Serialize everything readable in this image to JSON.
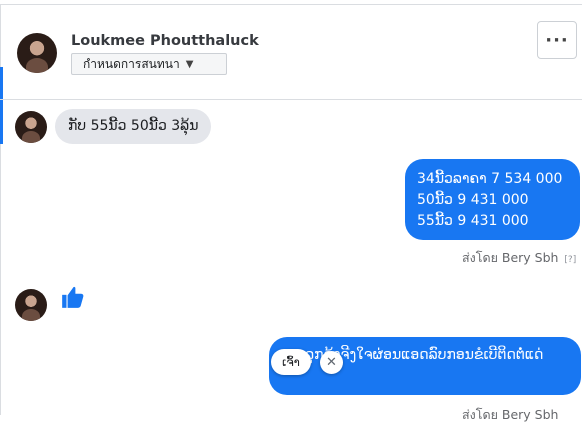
{
  "header": {
    "contact_name": "Loukmee Phoutthaluck",
    "dropdown_label": "กำหนดการสนทนา",
    "dropdown_caret": "▼",
    "more_label": "···"
  },
  "messages": {
    "incoming_text": "ກັບ 55ນີ້ວ 50ນີ້ວ 3ລຸ້ນ",
    "outgoing_lines": [
      "34ນີ້ວລາຄາ 7 534 000",
      "50ນີ້ວ 9 431 000",
      "55ນີ້ວ 9 431 000"
    ],
    "sent_by_label": "ส่งโดย Bery Sbh",
    "sent_by_help": "[?]",
    "reaction_icon": "thumbs-up",
    "outgoing2_text": "ລູກຄ້າຈີງໃຈຜ່ອນແອດລົບກອນຂໍເບີຕິດຕໍ່ແດ່",
    "sent_by_label_2": "ส่งโดย Bery Sbh"
  },
  "quick_reply": {
    "chip_label": "ເຈົ້າ",
    "close_label": "✕"
  },
  "colors": {
    "accent": "#1877f2",
    "incoming_bubble": "#e4e6eb",
    "divider": "#dadde1"
  }
}
